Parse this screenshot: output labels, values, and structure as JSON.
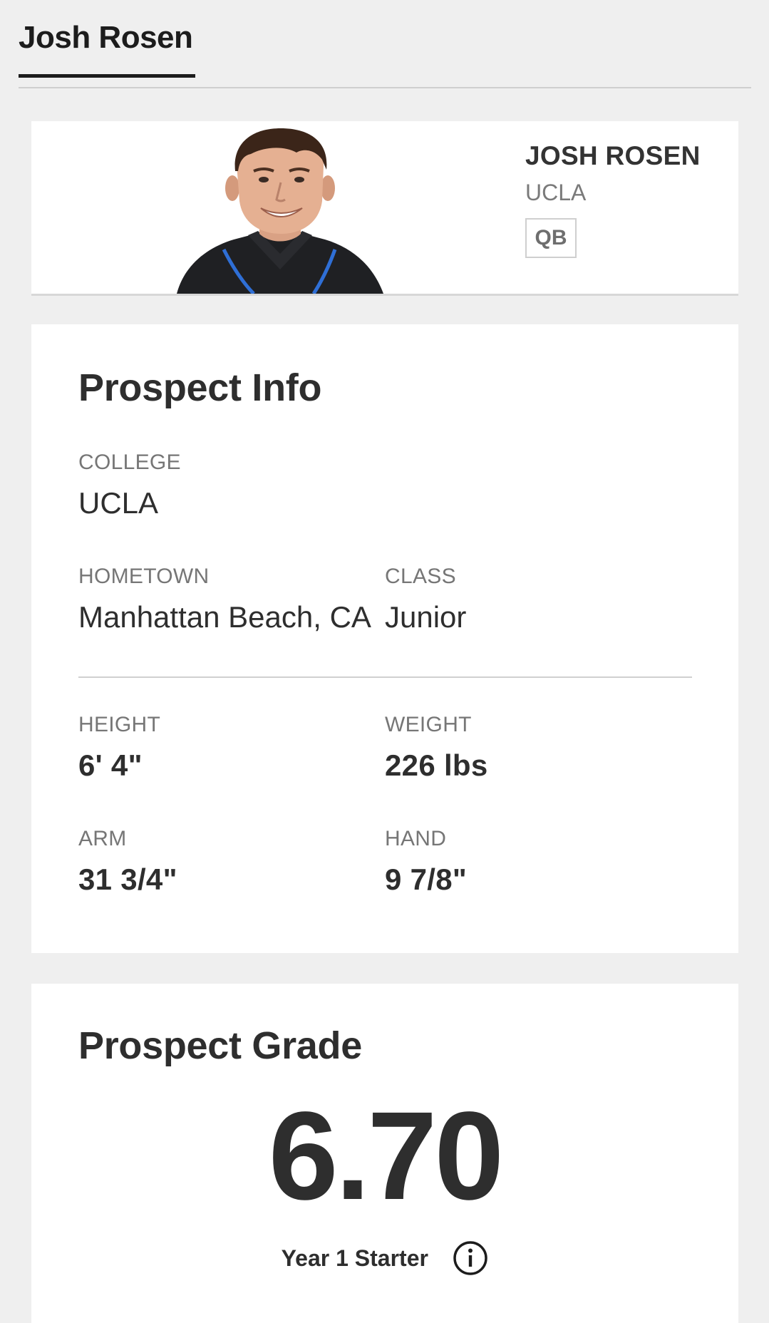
{
  "tabs": {
    "active_label": "Josh Rosen"
  },
  "player": {
    "name": "JOSH ROSEN",
    "school": "UCLA",
    "position": "QB",
    "photo_icon": "player-headshot"
  },
  "prospect_info": {
    "title": "Prospect Info",
    "college_label": "COLLEGE",
    "college_value": "UCLA",
    "hometown_label": "HOMETOWN",
    "hometown_value": "Manhattan Beach, CA",
    "class_label": "CLASS",
    "class_value": "Junior",
    "height_label": "HEIGHT",
    "height_value": "6' 4\"",
    "weight_label": "WEIGHT",
    "weight_value": "226 lbs",
    "arm_label": "ARM",
    "arm_value": "31 3/4\"",
    "hand_label": "HAND",
    "hand_value": "9 7/8\""
  },
  "prospect_grade": {
    "title": "Prospect Grade",
    "grade": "6.70",
    "description": "Year 1 Starter",
    "info_icon": "info-circle-icon"
  },
  "colors": {
    "background": "#efefef",
    "card": "#ffffff",
    "text_dark": "#2e2e2e",
    "text_muted": "#767676",
    "tab_underline": "#1c1c1c",
    "lanyard_blue": "#2f6fd6"
  }
}
